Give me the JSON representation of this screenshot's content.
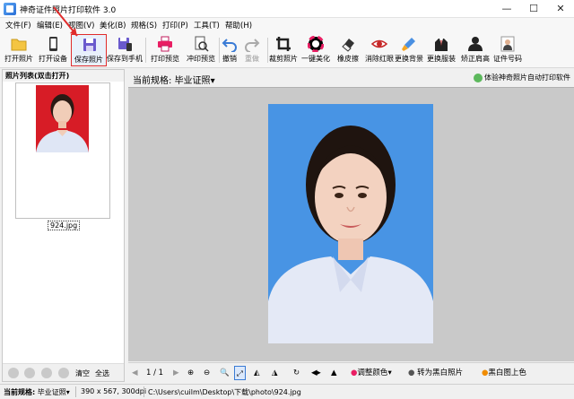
{
  "window": {
    "title": "神奇证件照片打印软件 3.0",
    "minimize": "—",
    "maximize": "☐",
    "close": "✕"
  },
  "menu": [
    "文件(F)",
    "编辑(E)",
    "视图(V)",
    "美化(B)",
    "规格(S)",
    "打印(P)",
    "工具(T)",
    "帮助(H)"
  ],
  "toolbar": [
    {
      "label": "打开照片",
      "icon": "folder-icon"
    },
    {
      "label": "打开设备",
      "icon": "phone-icon"
    },
    {
      "label": "保存照片",
      "icon": "save-icon",
      "active": true
    },
    {
      "label": "保存到手机",
      "icon": "save-phone-icon"
    },
    {
      "label": "打印预览",
      "icon": "printer-icon"
    },
    {
      "label": "冲印预览",
      "icon": "print-preview-icon"
    },
    {
      "label": "撤销",
      "icon": "undo-icon"
    },
    {
      "label": "重做",
      "icon": "redo-icon"
    },
    {
      "label": "裁剪照片",
      "icon": "crop-icon"
    },
    {
      "label": "一键美化",
      "icon": "color-wheel-icon"
    },
    {
      "label": "橡皮擦",
      "icon": "eraser-icon"
    },
    {
      "label": "消除红眼",
      "icon": "eye-icon"
    },
    {
      "label": "更换背景",
      "icon": "brush-icon"
    },
    {
      "label": "更换服装",
      "icon": "suit-icon"
    },
    {
      "label": "矫正肩高",
      "icon": "shoulder-icon"
    },
    {
      "label": "证件号码",
      "icon": "id-photo-icon"
    }
  ],
  "left_panel": {
    "header": "照片列表(双击打开)",
    "thumb_name": "924.jpg",
    "bottom": {
      "clear": "清空",
      "select_all": "全选"
    }
  },
  "main": {
    "spec_label": "当前规格:",
    "spec_value": "毕业证照",
    "spec_arrow": "▾",
    "experience_link": "体验神奇照片自动打印软件"
  },
  "bottom_toolbar": {
    "page": "1 / 1",
    "adjust_color": "调整颜色",
    "to_bw": "转为黑白照片",
    "bw_color": "黑白图上色"
  },
  "status": {
    "spec_label": "当前规格:",
    "spec_value": "毕业证照",
    "size": "390 x 567, 300dpi",
    "path": "C:\\Users\\cuilm\\Desktop\\下载\\photo\\924.jpg"
  },
  "colors": {
    "photo_bg_blue": "#4894e4",
    "thumb_bg_red": "#d71c26",
    "highlight_red": "#e02b2b"
  }
}
